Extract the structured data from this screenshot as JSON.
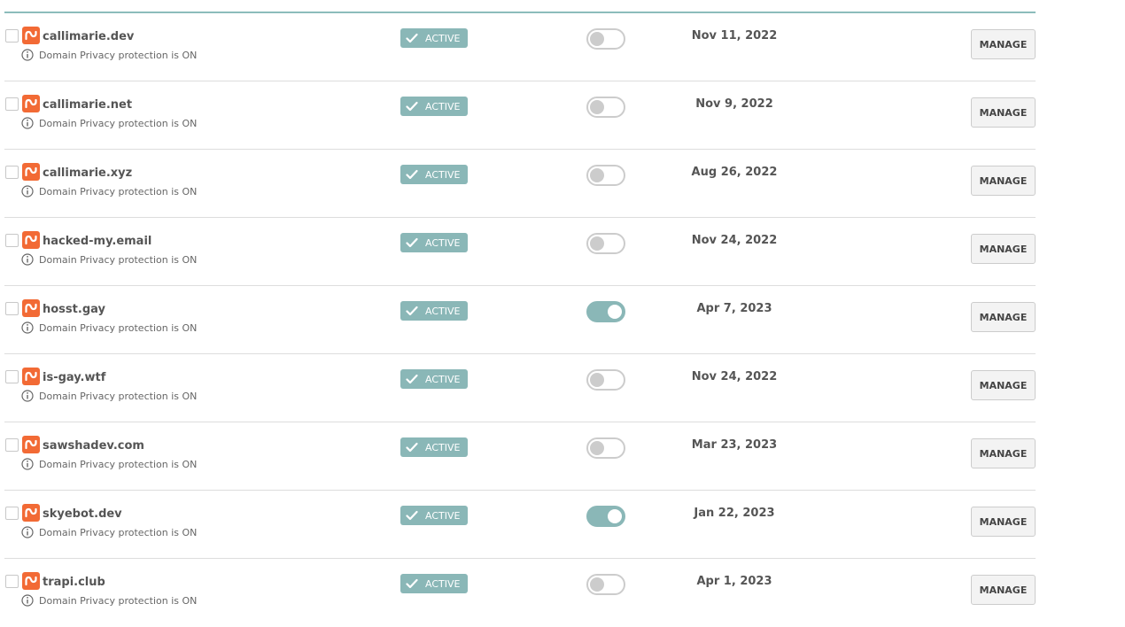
{
  "colors": {
    "accent": "#8ab7b7",
    "brand": "#f26a35",
    "divider": "#dddddd"
  },
  "icons": {
    "brand": "namecheap-logo-icon",
    "info": "info-icon",
    "status": "check-icon"
  },
  "domains": [
    {
      "name": "callimarie.dev",
      "privacy": "Domain Privacy protection is ON",
      "status": "ACTIVE",
      "autorenew": false,
      "date": "Nov 11, 2022",
      "action": "MANAGE"
    },
    {
      "name": "callimarie.net",
      "privacy": "Domain Privacy protection is ON",
      "status": "ACTIVE",
      "autorenew": false,
      "date": "Nov 9, 2022",
      "action": "MANAGE"
    },
    {
      "name": "callimarie.xyz",
      "privacy": "Domain Privacy protection is ON",
      "status": "ACTIVE",
      "autorenew": false,
      "date": "Aug 26, 2022",
      "action": "MANAGE"
    },
    {
      "name": "hacked-my.email",
      "privacy": "Domain Privacy protection is ON",
      "status": "ACTIVE",
      "autorenew": false,
      "date": "Nov 24, 2022",
      "action": "MANAGE"
    },
    {
      "name": "hosst.gay",
      "privacy": "Domain Privacy protection is ON",
      "status": "ACTIVE",
      "autorenew": true,
      "date": "Apr 7, 2023",
      "action": "MANAGE"
    },
    {
      "name": "is-gay.wtf",
      "privacy": "Domain Privacy protection is ON",
      "status": "ACTIVE",
      "autorenew": false,
      "date": "Nov 24, 2022",
      "action": "MANAGE"
    },
    {
      "name": "sawshadev.com",
      "privacy": "Domain Privacy protection is ON",
      "status": "ACTIVE",
      "autorenew": false,
      "date": "Mar 23, 2023",
      "action": "MANAGE"
    },
    {
      "name": "skyebot.dev",
      "privacy": "Domain Privacy protection is ON",
      "status": "ACTIVE",
      "autorenew": true,
      "date": "Jan 22, 2023",
      "action": "MANAGE"
    },
    {
      "name": "trapi.club",
      "privacy": "Domain Privacy protection is ON",
      "status": "ACTIVE",
      "autorenew": false,
      "date": "Apr 1, 2023",
      "action": "MANAGE"
    }
  ]
}
